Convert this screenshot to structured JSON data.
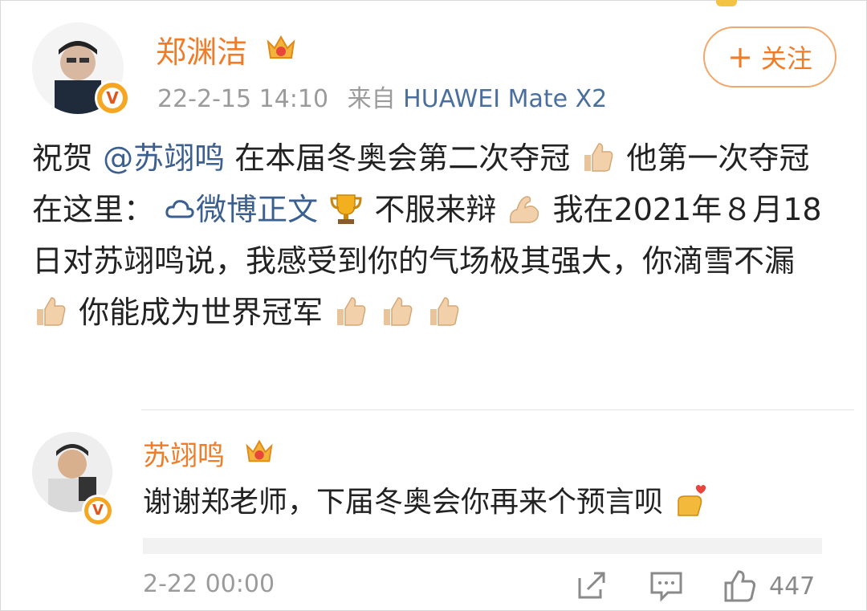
{
  "post": {
    "author": "郑渊洁",
    "timestamp": "22-2-15 14:10",
    "source_prefix": "来自",
    "device": "HUAWEI Mate X2",
    "follow_label": "关注",
    "follow_icon": "+",
    "text": {
      "line1_a": "祝贺",
      "mention": "@苏翊鸣",
      "line1_b": " 在本届冬奥会第二次夺冠",
      "line1_c": "他第一次夺冠在这里：",
      "link": "微博正文",
      "line2_b": "不服来辩",
      "line2_c": "我在2021年８月18日对苏翊鸣说，我感受到你的气场极其强大，你滴雪不漏",
      "line4_b": "你能成为世界冠军"
    },
    "emojis": [
      "thumbs-up-emoji",
      "muscle-emoji",
      "trophy-emoji"
    ]
  },
  "reply": {
    "author": "苏翊鸣",
    "text": "谢谢郑老师，下届冬奥会你再来个预言呗",
    "timestamp": "2-22 00:00",
    "like_count": "447"
  },
  "colors": {
    "name_orange": "#f07c28",
    "link_blue": "#3b5f8f",
    "meta_gray": "#9b9b9b",
    "badge_gold": "#f5a623"
  }
}
